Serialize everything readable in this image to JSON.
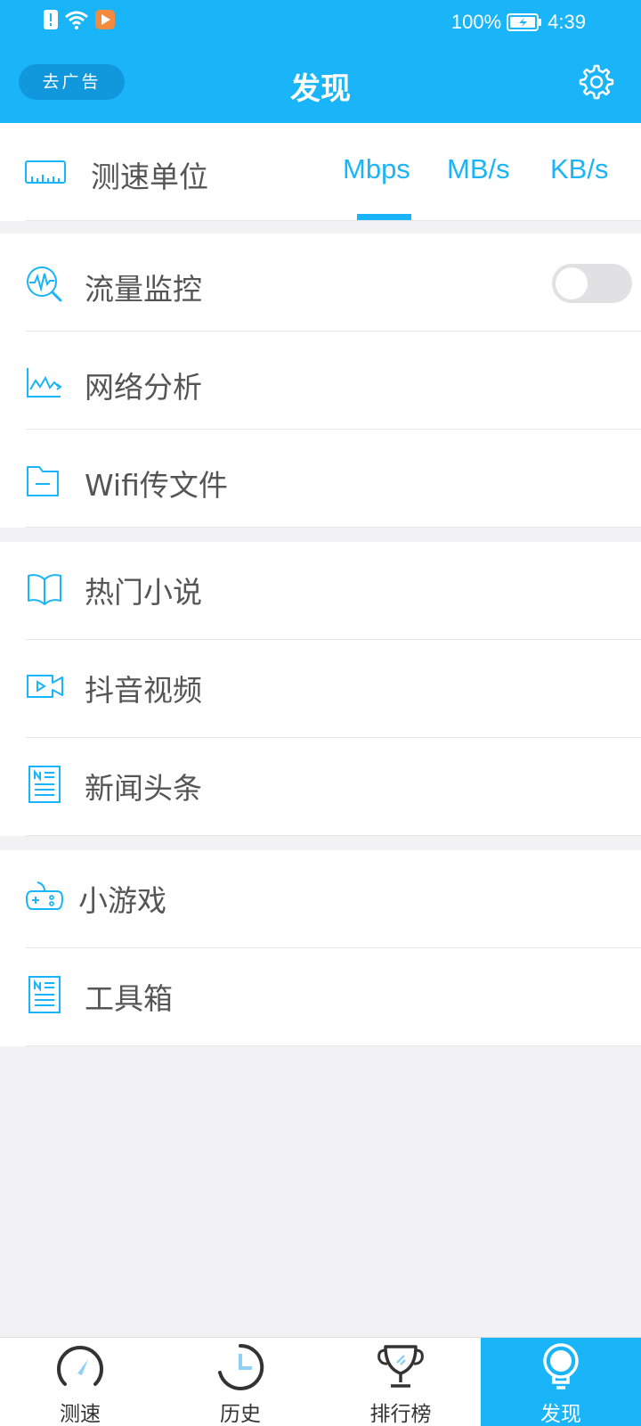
{
  "status_bar": {
    "battery": "100%",
    "time": "4:39"
  },
  "header": {
    "title": "发现",
    "remove_ads": "去广告",
    "settings_icon": "gear-icon"
  },
  "speed_unit": {
    "label": "测速单位",
    "options": [
      "Mbps",
      "MB/s",
      "KB/s"
    ],
    "selected": "Mbps"
  },
  "sections": [
    {
      "items": [
        {
          "label": "流量监控",
          "icon": "traffic-monitor-icon",
          "toggle": false
        },
        {
          "label": "网络分析",
          "icon": "network-analysis-icon"
        },
        {
          "label": "Wifi传文件",
          "icon": "folder-icon"
        }
      ]
    },
    {
      "items": [
        {
          "label": "热门小说",
          "icon": "book-icon"
        },
        {
          "label": "抖音视频",
          "icon": "video-icon"
        },
        {
          "label": "新闻头条",
          "icon": "news-icon"
        }
      ]
    },
    {
      "items": [
        {
          "label": "小游戏",
          "icon": "gamepad-icon"
        },
        {
          "label": "工具箱",
          "icon": "toolbox-icon"
        }
      ]
    }
  ],
  "bottom_nav": [
    {
      "label": "测速",
      "icon": "speedometer-icon"
    },
    {
      "label": "历史",
      "icon": "clock-icon"
    },
    {
      "label": "排行榜",
      "icon": "trophy-icon"
    },
    {
      "label": "发现",
      "icon": "lightbulb-icon",
      "active": true
    }
  ],
  "colors": {
    "primary": "#1ab4f8",
    "ad_button": "#1198dc",
    "background": "#f2f2f4"
  }
}
